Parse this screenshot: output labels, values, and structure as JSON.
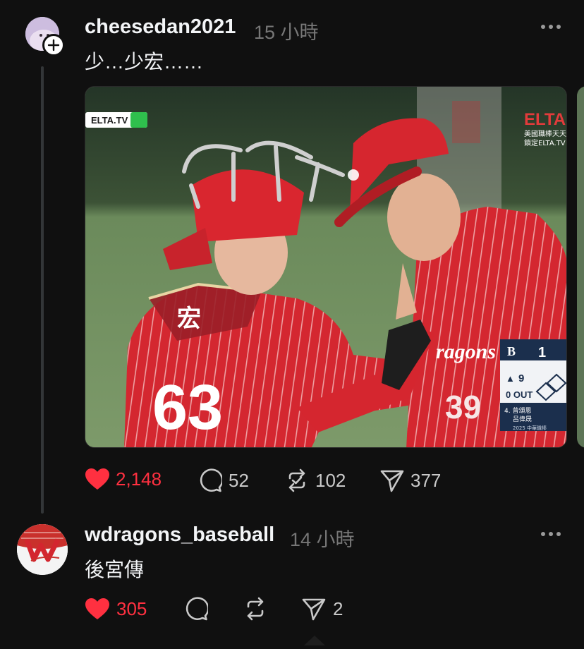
{
  "post1": {
    "username": "cheesedan2021",
    "time": "15 小時",
    "text": "少…少宏……",
    "more_icon": "more-horizontal-icon",
    "image": {
      "broadcaster_badge": "ELTA.TV",
      "top_right_logo": "ELTA",
      "top_right_line1": "美國職棒天天",
      "top_right_line2": "鎖定ELTA.TV",
      "jersey_left": "63",
      "jersey_left_name": "宏",
      "jersey_right": "39",
      "jersey_right_wordmark": "ragons",
      "scoreboard": {
        "score": "1",
        "inning": "9",
        "outs": "0 OUT",
        "line1": "4. 曾頌恩",
        "line2": "呂偉晟",
        "footer": "2025 中華職棒"
      }
    },
    "actions": {
      "likes": "2,148",
      "comments": "52",
      "reposts": "102",
      "shares": "377"
    }
  },
  "post2": {
    "username": "wdragons_baseball",
    "time": "14 小時",
    "text": "後宮傳",
    "more_icon": "more-horizontal-icon",
    "actions": {
      "likes": "305",
      "shares": "2"
    }
  },
  "colors": {
    "background": "#101010",
    "liked": "#ff3040",
    "muted": "#777777",
    "jersey_red": "#d3262f",
    "field_green": "#6d8a5c"
  }
}
